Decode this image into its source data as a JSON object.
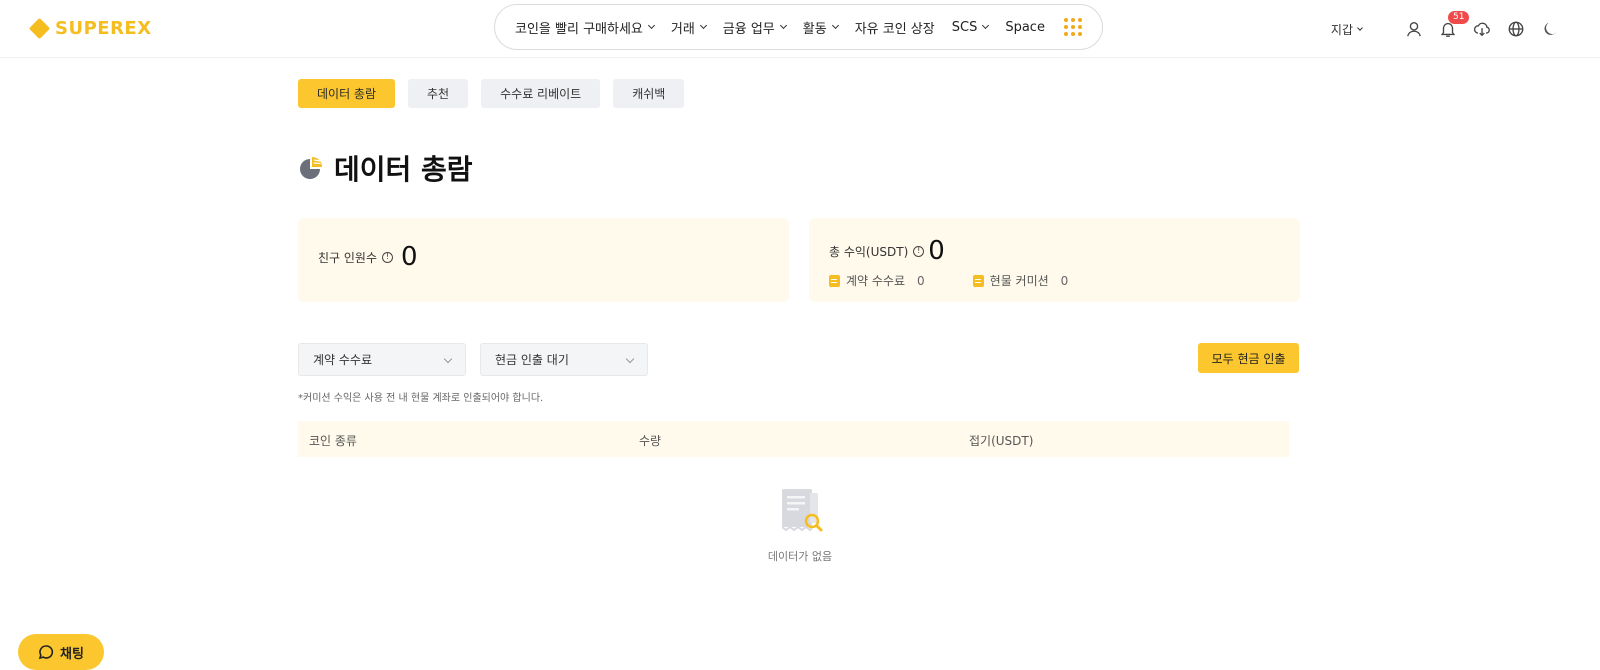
{
  "header": {
    "logo_text": "SUPEREX",
    "nav": [
      {
        "label": "코인을 빨리 구매하세요",
        "dropdown": true
      },
      {
        "label": "거래",
        "dropdown": true
      },
      {
        "label": "금융 업무",
        "dropdown": true
      },
      {
        "label": "활동",
        "dropdown": true
      },
      {
        "label": "자유 코인 상장",
        "dropdown": false
      },
      {
        "label": "SCS",
        "dropdown": true
      },
      {
        "label": "Space",
        "dropdown": false
      }
    ],
    "wallet_label": "지갑",
    "notification_count": "51",
    "icons": [
      "user-icon",
      "bell-icon",
      "download-icon",
      "globe-icon",
      "moon-icon"
    ]
  },
  "tabs": [
    {
      "label": "데이터 총람",
      "active": true
    },
    {
      "label": "추천",
      "active": false
    },
    {
      "label": "수수료 리베이트",
      "active": false
    },
    {
      "label": "캐쉬백",
      "active": false
    }
  ],
  "page_title": "데이터 총람",
  "cards": {
    "friends": {
      "label": "친구 인원수",
      "value": "0"
    },
    "earnings": {
      "label": "총 수익(USDT)",
      "value": "0",
      "items": [
        {
          "label": "계약 수수료",
          "value": "0"
        },
        {
          "label": "현물 커미션",
          "value": "0"
        }
      ]
    }
  },
  "filters": {
    "type_select": "계약 수수료",
    "status_select": "현금 인출 대기",
    "withdraw_all_label": "모두 현금 인출"
  },
  "note": "*커미션 수익은 사용 전 내 현물 계좌로 인출되어야 합니다.",
  "table": {
    "columns": [
      "코인 종류",
      "수량",
      "접기(USDT)"
    ],
    "rows": [],
    "empty_text": "데이터가 없음"
  },
  "chat_label": "채팅",
  "colors": {
    "accent": "#fcc72e",
    "card_bg": "#fffaeb",
    "badge": "#f04a4a"
  }
}
